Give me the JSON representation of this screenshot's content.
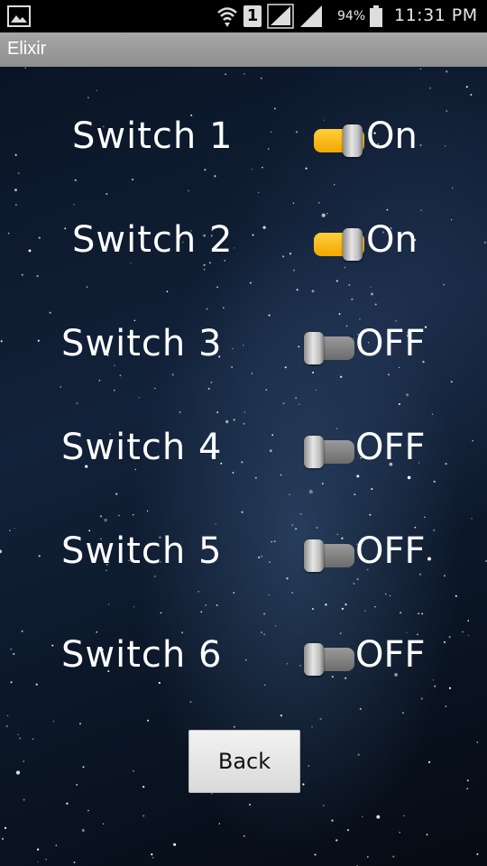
{
  "status_bar": {
    "battery_percent": "94%",
    "time": "11:31 PM",
    "sim_slot": "1",
    "icons": [
      "gallery-icon",
      "wifi-icon",
      "sim-icon",
      "signal-icon",
      "signal-icon",
      "battery-icon"
    ]
  },
  "app": {
    "title": "Elixir"
  },
  "switches": [
    {
      "label": "Switch 1",
      "state": "On",
      "on": true
    },
    {
      "label": "Switch 2",
      "state": "On",
      "on": true
    },
    {
      "label": "Switch 3",
      "state": "OFF",
      "on": false
    },
    {
      "label": "Switch 4",
      "state": "OFF",
      "on": false
    },
    {
      "label": "Switch 5",
      "state": "OFF",
      "on": false
    },
    {
      "label": "Switch 6",
      "state": "OFF",
      "on": false
    }
  ],
  "back_button": {
    "label": "Back"
  },
  "colors": {
    "toggle_on": "#f6b800",
    "toggle_off": "#7d7d7d",
    "title_bar": "#9a9a9a"
  }
}
